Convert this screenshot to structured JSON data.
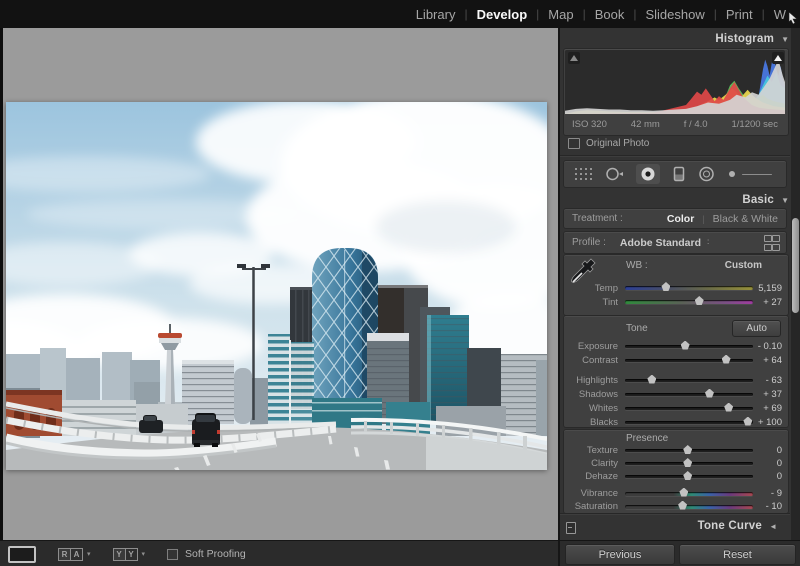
{
  "menu": {
    "separator": "|",
    "items": [
      {
        "label": "Library",
        "active": false
      },
      {
        "label": "Develop",
        "active": true
      },
      {
        "label": "Map",
        "active": false
      },
      {
        "label": "Book",
        "active": false
      },
      {
        "label": "Slideshow",
        "active": false
      },
      {
        "label": "Print",
        "active": false
      },
      {
        "label": "W",
        "active": false
      }
    ]
  },
  "histogram": {
    "title": "Histogram",
    "collapse_icon": "▼",
    "exif": {
      "iso": "ISO 320",
      "focal_length": "42 mm",
      "aperture": "f / 4.0",
      "shutter": "1/1200 sec"
    },
    "original_photo_label": "Original Photo",
    "series": [
      {
        "name": "blue",
        "color": "#4a7ae6",
        "points": [
          [
            82,
            4
          ],
          [
            86,
            15
          ],
          [
            88,
            28
          ],
          [
            90,
            70
          ],
          [
            91,
            85
          ],
          [
            92,
            75
          ],
          [
            93,
            60
          ],
          [
            94,
            80
          ],
          [
            95,
            88
          ],
          [
            96,
            70
          ],
          [
            97,
            60
          ],
          [
            98,
            75
          ],
          [
            99,
            55
          ],
          [
            100,
            45
          ]
        ]
      },
      {
        "name": "cyan",
        "color": "#46c8dc",
        "points": [
          [
            80,
            5
          ],
          [
            84,
            12
          ],
          [
            88,
            30
          ],
          [
            90,
            45
          ],
          [
            92,
            60
          ],
          [
            94,
            50
          ],
          [
            96,
            65
          ],
          [
            98,
            45
          ],
          [
            100,
            40
          ]
        ]
      },
      {
        "name": "green",
        "color": "#5cc45c",
        "points": [
          [
            55,
            4
          ],
          [
            60,
            8
          ],
          [
            65,
            12
          ],
          [
            70,
            18
          ],
          [
            73,
            28
          ],
          [
            75,
            45
          ],
          [
            77,
            52
          ],
          [
            79,
            40
          ],
          [
            81,
            30
          ],
          [
            83,
            24
          ],
          [
            85,
            30
          ],
          [
            87,
            24
          ],
          [
            90,
            30
          ],
          [
            92,
            24
          ],
          [
            95,
            20
          ],
          [
            100,
            16
          ]
        ]
      },
      {
        "name": "yellow",
        "color": "#ead84e",
        "points": [
          [
            5,
            4
          ],
          [
            10,
            6
          ],
          [
            15,
            5
          ],
          [
            20,
            4
          ],
          [
            30,
            3
          ],
          [
            40,
            3
          ],
          [
            50,
            5
          ],
          [
            55,
            8
          ],
          [
            60,
            12
          ],
          [
            65,
            20
          ],
          [
            68,
            26
          ],
          [
            70,
            22
          ],
          [
            73,
            30
          ],
          [
            76,
            40
          ],
          [
            78,
            34
          ],
          [
            80,
            26
          ],
          [
            83,
            38
          ],
          [
            85,
            30
          ],
          [
            87,
            24
          ],
          [
            90,
            18
          ],
          [
            95,
            12
          ],
          [
            100,
            10
          ]
        ]
      },
      {
        "name": "red",
        "color": "#e04848",
        "points": [
          [
            40,
            2
          ],
          [
            45,
            6
          ],
          [
            50,
            10
          ],
          [
            55,
            14
          ],
          [
            57,
            22
          ],
          [
            60,
            35
          ],
          [
            62,
            30
          ],
          [
            64,
            40
          ],
          [
            66,
            30
          ],
          [
            68,
            20
          ],
          [
            70,
            28
          ],
          [
            72,
            22
          ],
          [
            75,
            40
          ],
          [
            77,
            50
          ],
          [
            79,
            38
          ],
          [
            81,
            26
          ],
          [
            83,
            20
          ],
          [
            85,
            14
          ],
          [
            88,
            10
          ],
          [
            92,
            8
          ],
          [
            100,
            6
          ]
        ]
      },
      {
        "name": "gray",
        "color": "#d4d4d4",
        "points": [
          [
            0,
            5
          ],
          [
            5,
            8
          ],
          [
            10,
            9
          ],
          [
            15,
            8
          ],
          [
            20,
            7
          ],
          [
            25,
            7
          ],
          [
            30,
            6
          ],
          [
            35,
            6
          ],
          [
            40,
            5
          ],
          [
            45,
            6
          ],
          [
            50,
            7
          ],
          [
            55,
            8
          ],
          [
            60,
            12
          ],
          [
            65,
            18
          ],
          [
            70,
            16
          ],
          [
            75,
            22
          ],
          [
            78,
            30
          ],
          [
            82,
            26
          ],
          [
            85,
            34
          ],
          [
            88,
            30
          ],
          [
            90,
            40
          ],
          [
            93,
            55
          ],
          [
            95,
            70
          ],
          [
            97,
            85
          ],
          [
            99,
            60
          ],
          [
            100,
            50
          ]
        ]
      }
    ]
  },
  "toolstrip": {
    "icons": [
      "crop-overlay",
      "spot-removal",
      "red-eye",
      "graduated-filter",
      "radial-filter",
      "adjustment-brush"
    ]
  },
  "basic": {
    "title": "Basic",
    "collapse_icon": "▼",
    "treatment": {
      "label": "Treatment :",
      "color_option": "Color",
      "bw_option": "Black & White",
      "separator": "|"
    },
    "profile": {
      "label": "Profile :",
      "value": "Adobe Standard",
      "dropdown_glyph": "∶"
    },
    "wb": {
      "label": "WB :",
      "value": "Custom",
      "dropdown_glyph": "∶",
      "sliders": [
        {
          "label": "Temp",
          "value": "5,159",
          "pct": 32,
          "track": "temp"
        },
        {
          "label": "Tint",
          "value": "+ 27",
          "pct": 58,
          "track": "tint"
        }
      ]
    },
    "tone": {
      "label": "Tone",
      "auto_label": "Auto",
      "sliders": [
        {
          "label": "Exposure",
          "value": "- 0.10",
          "pct": 47
        },
        {
          "label": "Contrast",
          "value": "+ 64",
          "pct": 79
        },
        {
          "label": "Highlights",
          "value": "- 63",
          "pct": 21,
          "gap_before": true
        },
        {
          "label": "Shadows",
          "value": "+ 37",
          "pct": 66
        },
        {
          "label": "Whites",
          "value": "+ 69",
          "pct": 81
        },
        {
          "label": "Blacks",
          "value": "+ 100",
          "pct": 96
        }
      ]
    },
    "presence": {
      "label": "Presence",
      "sliders": [
        {
          "label": "Texture",
          "value": "0",
          "pct": 49
        },
        {
          "label": "Clarity",
          "value": "0",
          "pct": 49
        },
        {
          "label": "Dehaze",
          "value": "0",
          "pct": 49
        },
        {
          "label": "Vibrance",
          "value": "- 9",
          "pct": 46,
          "track": "vibrance",
          "gap_before": true
        },
        {
          "label": "Saturation",
          "value": "- 10",
          "pct": 45,
          "track": "vibrance"
        }
      ]
    }
  },
  "tone_curve": {
    "title": "Tone Curve",
    "collapse_icon": "◄"
  },
  "footer_buttons": {
    "previous": "Previous",
    "reset": "Reset"
  },
  "toolbar": {
    "soft_proofing_label": "Soft Proofing",
    "ba_letters": {
      "r": "R",
      "a": "A",
      "y1": "Y",
      "y2": "Y"
    },
    "dropdown_arrow": "▾"
  },
  "colors": {
    "accent_gray": "#9b9b9b",
    "panel": "#333333",
    "topbar": "#121212"
  },
  "photo": {
    "description": "Downtown Calgary skyline with The Bow diagrid tower and Calgary Tower, viewed from a curving elevated highway with white guardrails, a dark SUV and a car on the road, blue sky with large white clouds"
  }
}
